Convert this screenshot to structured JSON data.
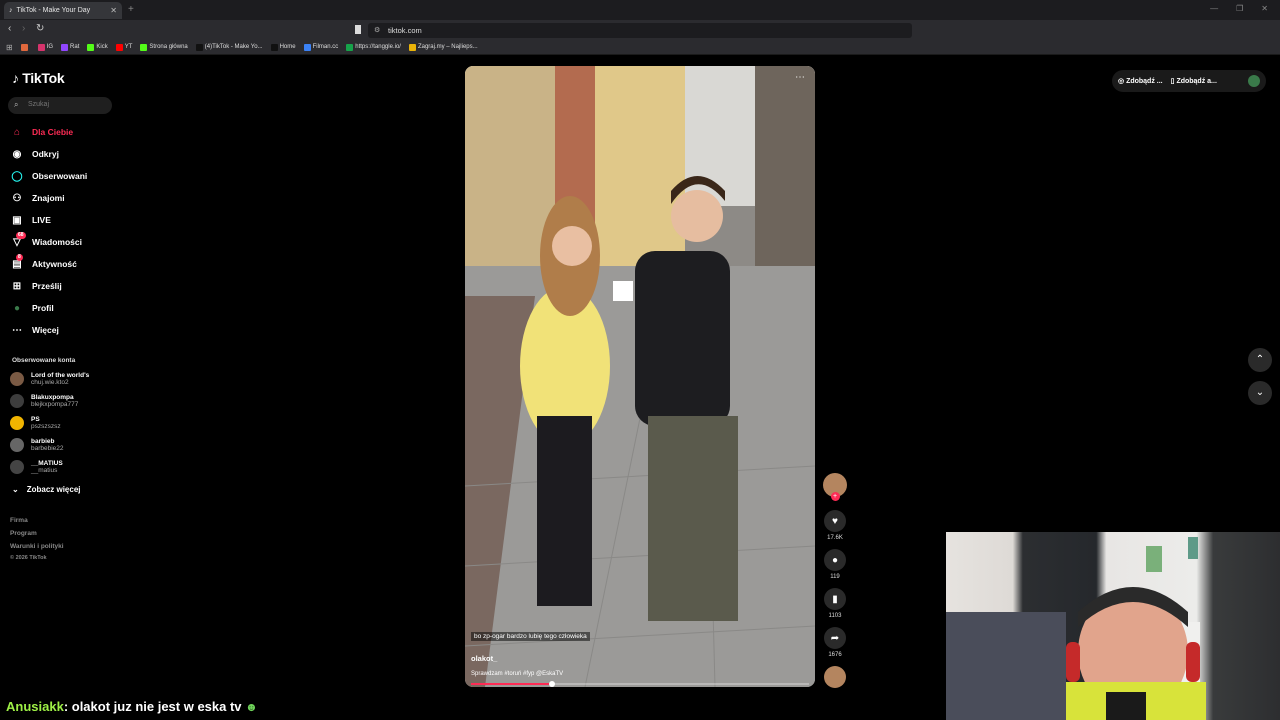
{
  "browser": {
    "tab_title": "TikTok - Make Your Day",
    "url": "tiktok.com",
    "bookmarks": [
      {
        "label": "",
        "color": "#e0683d"
      },
      {
        "label": "IG",
        "color": "#d6336c"
      },
      {
        "label": "Rat",
        "color": "#9146ff"
      },
      {
        "label": "Kick",
        "color": "#53fc18"
      },
      {
        "label": "YT",
        "color": "#ff0000"
      },
      {
        "label": "Strona główna",
        "color": "#53fc18"
      },
      {
        "label": "(4)TikTok - Make Yo...",
        "color": "#111111"
      },
      {
        "label": "Home",
        "color": "#111111"
      },
      {
        "label": "Filman.cc",
        "color": "#3b82f6"
      },
      {
        "label": "https://tanggle.io/",
        "color": "#16a34a"
      },
      {
        "label": "Zagraj.my – Najlieps...",
        "color": "#eab308"
      }
    ]
  },
  "sidebar": {
    "logo": "TikTok",
    "search_placeholder": "Szukaj",
    "nav": [
      {
        "label": "Dla Ciebie",
        "icon": "home-icon",
        "active": true
      },
      {
        "label": "Odkryj",
        "icon": "compass-icon"
      },
      {
        "label": "Obserwowani",
        "icon": "following-icon"
      },
      {
        "label": "Znajomi",
        "icon": "friends-icon"
      },
      {
        "label": "LIVE",
        "icon": "live-icon"
      },
      {
        "label": "Wiadomości",
        "icon": "messages-icon",
        "badge": "68"
      },
      {
        "label": "Aktywność",
        "icon": "activity-icon",
        "badge": "8"
      },
      {
        "label": "Prześlij",
        "icon": "upload-icon"
      },
      {
        "label": "Profil",
        "icon": "profile-icon"
      },
      {
        "label": "Więcej",
        "icon": "more-icon"
      }
    ],
    "following_title": "Obserwowane konta",
    "following": [
      {
        "name": "Lord of the world's",
        "handle": "chuj.wie.kto2"
      },
      {
        "name": "Blakuxpompa",
        "handle": "blejkxpompa777"
      },
      {
        "name": "PS",
        "handle": "pszszszsz"
      },
      {
        "name": "barbieb",
        "handle": "barbebie22"
      },
      {
        "name": "__MATIUS",
        "handle": "__matius"
      }
    ],
    "see_more": "Zobacz więcej",
    "footer": [
      "Firma",
      "Program",
      "Warunki i polityki",
      "© 2026 TikTok"
    ]
  },
  "video": {
    "subtitle": "bo zp-ogar bardzo lubię tego człowieka",
    "author": "olakot_",
    "description": "Sprawdzam #toruń #fyp @EskaTV",
    "progress": 0.24
  },
  "actions": {
    "likes": "17.6K",
    "comments": "119",
    "saves": "1103",
    "shares": "1676"
  },
  "top_right": {
    "btn1": "Zdobądź ...",
    "btn2": "Zdobądź a..."
  },
  "chat": {
    "user": "Anusiakk",
    "message": ": olakot juz nie jest w eska tv"
  }
}
